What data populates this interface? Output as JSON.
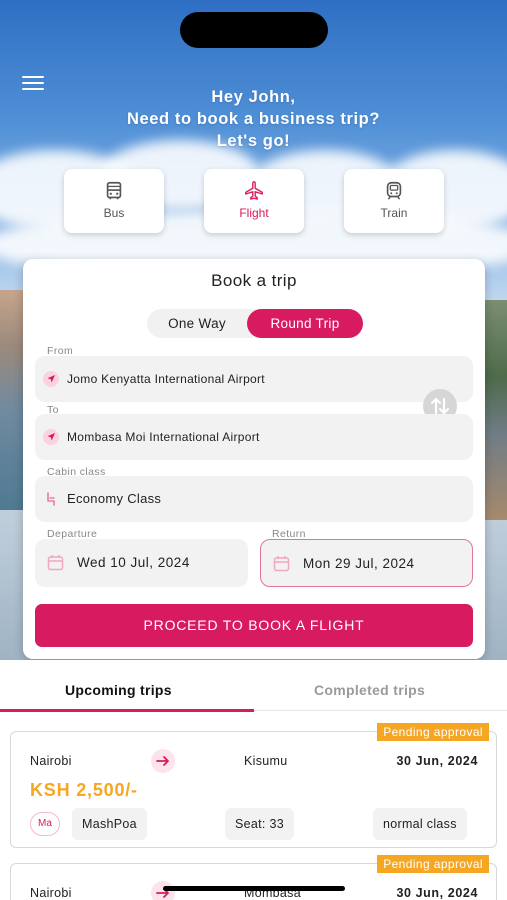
{
  "greeting": {
    "line1": "Hey John,",
    "line2": "Need to book a business trip?",
    "line3": "Let's go!"
  },
  "transport_modes": [
    {
      "label": "Bus",
      "icon": "bus-icon",
      "active": false
    },
    {
      "label": "Flight",
      "icon": "airplane-icon",
      "active": true
    },
    {
      "label": "Train",
      "icon": "train-icon",
      "active": false
    }
  ],
  "booking": {
    "title": "Book a trip",
    "trip_types": [
      "One Way",
      "Round Trip"
    ],
    "selected_trip_type": "Round Trip",
    "from_label": "From",
    "from_value": "Jomo Kenyatta International Airport",
    "to_label": "To",
    "to_value": "Mombasa Moi International Airport",
    "cabin_label": "Cabin class",
    "cabin_value": "Economy Class",
    "departure_label": "Departure",
    "departure_value": "Wed 10 Jul, 2024",
    "return_label": "Return",
    "return_value": "Mon 29 Jul, 2024",
    "cta_label": "PROCEED TO BOOK A FLIGHT"
  },
  "tabs": {
    "upcoming": "Upcoming trips",
    "completed": "Completed trips",
    "active": "upcoming"
  },
  "trips": [
    {
      "status": "Pending approval",
      "from": "Nairobi",
      "to": "Kisumu",
      "date": "30 Jun, 2024",
      "price": "KSH 2,500/-",
      "operator_logo": "Ma",
      "operator": "MashPoa",
      "seat": "Seat: 33",
      "class": "normal class"
    },
    {
      "status": "Pending approval",
      "from": "Nairobi",
      "to": "Mombasa",
      "date": "30 Jun, 2024"
    }
  ],
  "colors": {
    "accent": "#d81b60",
    "price": "#f5a623",
    "badge": "#f5a623"
  }
}
